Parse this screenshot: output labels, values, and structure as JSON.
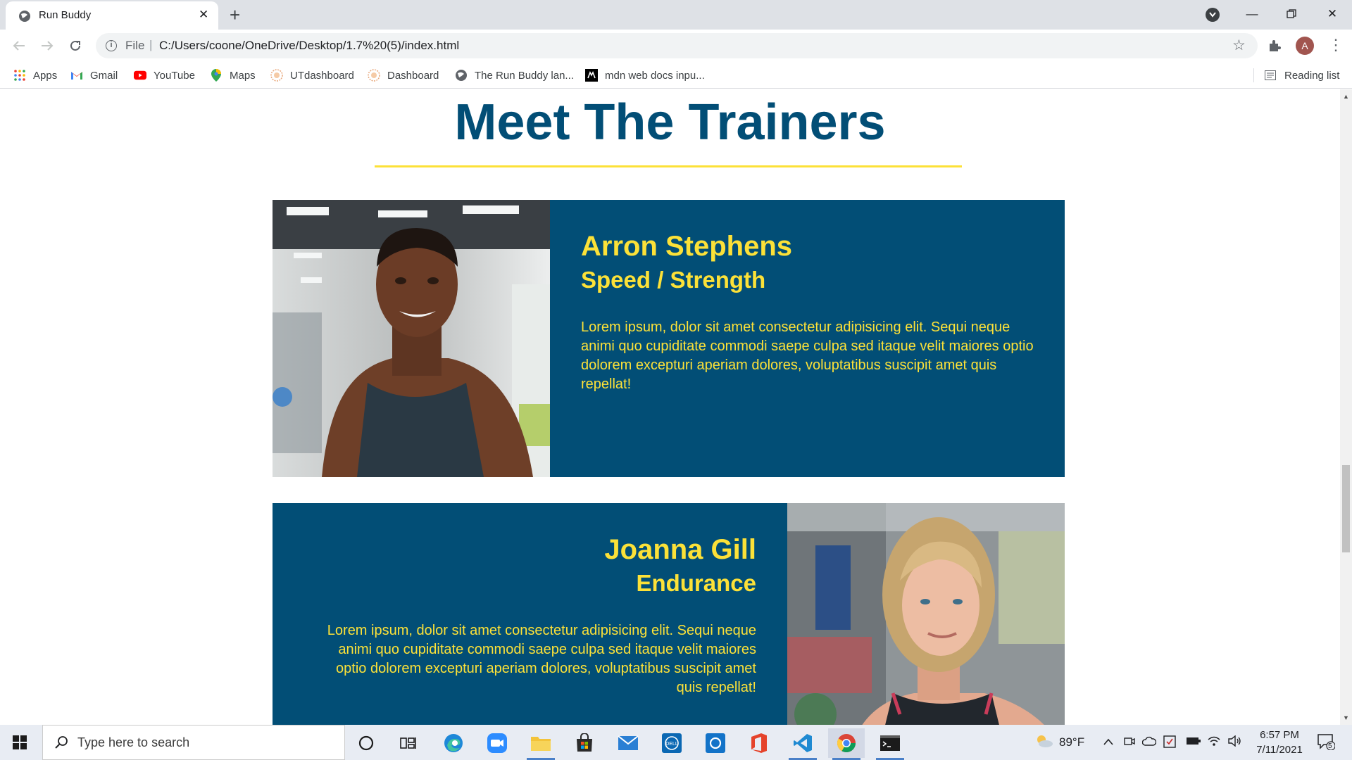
{
  "browser": {
    "tab_title": "Run Buddy",
    "url_scheme": "File",
    "url": "C:/Users/coone/OneDrive/Desktop/1.7%20(5)/index.html",
    "profile_initial": "A",
    "bookmarks": [
      {
        "label": "Apps",
        "icon": "apps-grid-icon"
      },
      {
        "label": "Gmail",
        "icon": "gmail-icon"
      },
      {
        "label": "YouTube",
        "icon": "youtube-icon"
      },
      {
        "label": "Maps",
        "icon": "maps-pin-icon"
      },
      {
        "label": "UTdashboard",
        "icon": "ut-icon"
      },
      {
        "label": "Dashboard",
        "icon": "ut-icon"
      },
      {
        "label": "The Run Buddy lan...",
        "icon": "globe-icon"
      },
      {
        "label": "mdn web docs inpu...",
        "icon": "mdn-icon"
      }
    ],
    "reading_list": "Reading list"
  },
  "page": {
    "section_title": "Meet The Trainers",
    "trainers": [
      {
        "name": "Arron Stephens",
        "role": "Speed / Strength",
        "bio": "Lorem ipsum, dolor sit amet consectetur adipisicing elit. Sequi neque animi quo cupiditate commodi saepe culpa sed itaque velit maiores optio dolorem excepturi aperiam dolores, voluptatibus suscipit amet quis repellat!"
      },
      {
        "name": "Joanna Gill",
        "role": "Endurance",
        "bio": "Lorem ipsum, dolor sit amet consectetur adipisicing elit. Sequi neque animi quo cupiditate commodi saepe culpa sed itaque velit maiores optio dolorem excepturi aperiam dolores, voluptatibus suscipit amet quis repellat!"
      }
    ]
  },
  "colors": {
    "brand_blue": "#024e76",
    "accent_yellow": "#fce138"
  },
  "taskbar": {
    "search_placeholder": "Type here to search",
    "temperature": "89°F",
    "time": "6:57 PM",
    "date": "7/11/2021",
    "notification_count": "5"
  }
}
